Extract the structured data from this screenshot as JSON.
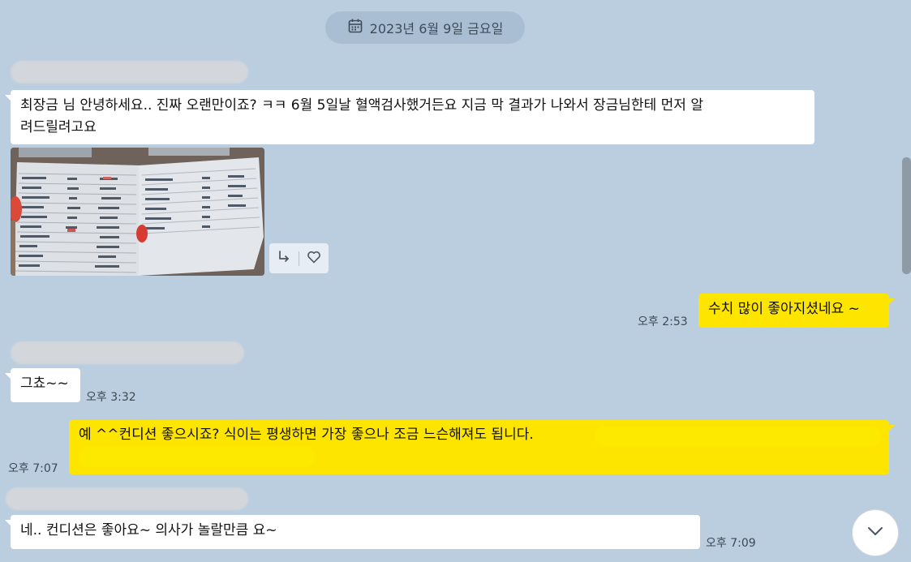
{
  "date_divider": {
    "label": "2023년 6월 9일 금요일",
    "icon": "calendar-icon"
  },
  "messages": [
    {
      "text_line1": "최장금 님 안녕하세요.. 진짜 오랜만이죠? ㅋㅋ 6월 5일날 혈액검사했거든요 지금 막 결과가 나와서 장금님한테 먼저 알",
      "text_line2": "려드릴려고요"
    },
    {
      "text": "수치 많이 좋아지셨네요 ~",
      "time": "오후 2:53"
    },
    {
      "text": "그쵸~~",
      "time": "오후 3:32"
    },
    {
      "text": "예 ^^컨디션 좋으시죠? 식이는 평생하면 가장 좋으나 조금 느슨해져도 됩니다.",
      "time": "오후 7:07"
    },
    {
      "text": "네.. 컨디션은 좋아요~ 의사가 놀랄만큼 요~",
      "time": "오후 7:09"
    }
  ],
  "photo_actions": {
    "share_icon": "share-arrow-icon",
    "like_icon": "heart-icon"
  },
  "scroll_down_icon": "chevron-down-icon",
  "colors": {
    "background": "#bacee0",
    "my_bubble": "#fee500",
    "their_bubble": "#ffffff"
  }
}
